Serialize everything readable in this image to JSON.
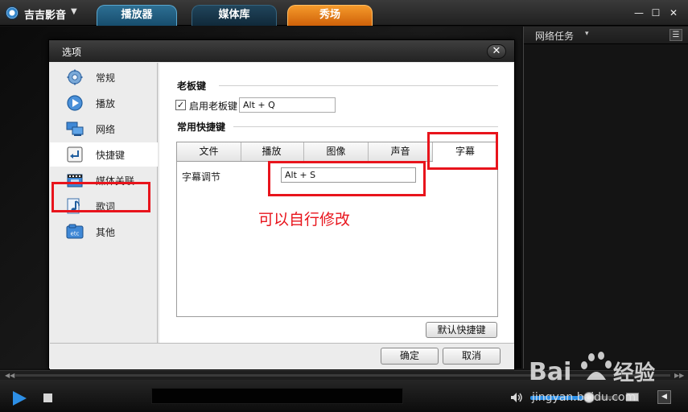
{
  "titlebar": {
    "app_name": "吉吉影音",
    "menu_arrow": "▼",
    "tabs": [
      {
        "label": "播放器"
      },
      {
        "label": "媒体库"
      },
      {
        "label": "秀场"
      }
    ],
    "controls": {
      "minimize": "—",
      "maximize": "☐",
      "close": "✕"
    }
  },
  "right_panel": {
    "title": "网络任务",
    "title_arrow": "▾",
    "menu_glyph": "☰"
  },
  "dialog": {
    "title": "选项",
    "close_glyph": "✕",
    "nav": [
      {
        "label": "常规",
        "icon": "gear-icon"
      },
      {
        "label": "播放",
        "icon": "play-circle-icon"
      },
      {
        "label": "网络",
        "icon": "network-icon"
      },
      {
        "label": "快捷键",
        "icon": "shortcut-key-icon",
        "selected": true
      },
      {
        "label": "媒体关联",
        "icon": "film-icon"
      },
      {
        "label": "歌词",
        "icon": "music-note-icon"
      },
      {
        "label": "其他",
        "icon": "etc-icon"
      }
    ],
    "boss_key": {
      "section_title": "老板键",
      "checkbox_label": "启用老板键",
      "checked": true,
      "check_glyph": "✓",
      "value": "Alt + Q"
    },
    "hotkeys": {
      "section_title": "常用快捷键",
      "tabs": [
        {
          "label": "文件"
        },
        {
          "label": "播放"
        },
        {
          "label": "图像"
        },
        {
          "label": "声音"
        },
        {
          "label": "字幕",
          "active": true
        }
      ],
      "row_label": "字幕调节",
      "row_value": "Alt + S",
      "default_button": "默认快捷键"
    },
    "annotation": "可以自行修改",
    "ok_button": "确定",
    "cancel_button": "取消"
  },
  "player": {
    "volume_level": 0.62,
    "panel_toggle_glyph": "◀"
  },
  "watermark": {
    "brand": "Bai",
    "brand_cn": "经验",
    "url": "jingyan.baidu.com"
  },
  "colors": {
    "accent_blue": "#2d8fe6",
    "highlight_red": "#e8141c",
    "show_tab_orange": "#f08a1e"
  }
}
